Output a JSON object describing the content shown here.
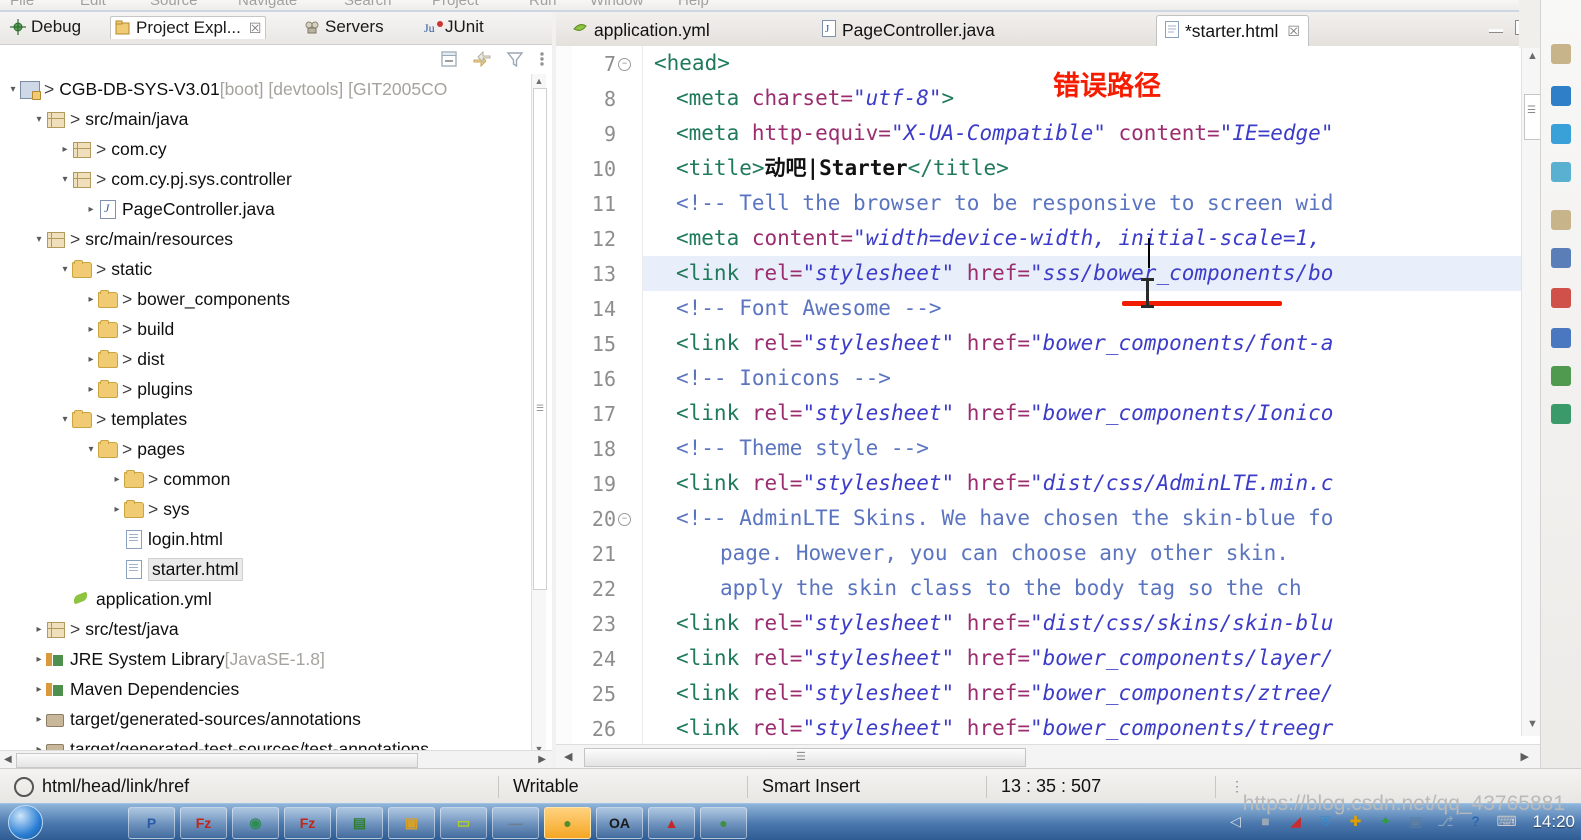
{
  "menu": {
    "items": [
      "File",
      "Edit",
      "Source",
      "Navigate",
      "Search",
      "Project",
      "Run",
      "Window",
      "Help"
    ]
  },
  "left_panel": {
    "view_tabs": [
      {
        "label": "Debug",
        "icon": "debug-icon",
        "active": false
      },
      {
        "label": "Project Expl...",
        "icon": "project-explorer-icon",
        "active": true
      },
      {
        "label": "Servers",
        "icon": "servers-icon",
        "active": false
      },
      {
        "label": "JUnit",
        "icon": "junit-icon",
        "active": false
      }
    ],
    "toolbar": [
      {
        "name": "collapse-all-icon"
      },
      {
        "name": "link-with-editor-icon"
      },
      {
        "name": "filter-icon"
      },
      {
        "name": "view-menu-icon"
      }
    ],
    "tree": [
      {
        "indent": 0,
        "twisty": "open",
        "icon": "project-icon",
        "arrow": ">",
        "label": "CGB-DB-SYS-V3.01",
        "suffix": " [boot] [devtools] [GIT2005CO",
        "selected": false
      },
      {
        "indent": 1,
        "twisty": "open",
        "icon": "source-folder-icon",
        "arrow": ">",
        "label": "src/main/java",
        "suffix": "",
        "selected": false
      },
      {
        "indent": 2,
        "twisty": "closed",
        "icon": "package-icon",
        "arrow": ">",
        "label": "com.cy",
        "suffix": "",
        "selected": false
      },
      {
        "indent": 2,
        "twisty": "open",
        "icon": "package-icon",
        "arrow": ">",
        "label": "com.cy.pj.sys.controller",
        "suffix": "",
        "selected": false
      },
      {
        "indent": 3,
        "twisty": "closed",
        "icon": "java-file-icon",
        "arrow": "",
        "label": "PageController.java",
        "suffix": "",
        "selected": false
      },
      {
        "indent": 1,
        "twisty": "open",
        "icon": "source-folder-icon",
        "arrow": ">",
        "label": "src/main/resources",
        "suffix": "",
        "selected": false
      },
      {
        "indent": 2,
        "twisty": "open",
        "icon": "folder-icon",
        "arrow": ">",
        "label": "static",
        "suffix": "",
        "selected": false
      },
      {
        "indent": 3,
        "twisty": "closed",
        "icon": "folder-icon",
        "arrow": ">",
        "label": "bower_components",
        "suffix": "",
        "selected": false
      },
      {
        "indent": 3,
        "twisty": "closed",
        "icon": "folder-icon",
        "arrow": ">",
        "label": "build",
        "suffix": "",
        "selected": false
      },
      {
        "indent": 3,
        "twisty": "closed",
        "icon": "folder-icon",
        "arrow": ">",
        "label": "dist",
        "suffix": "",
        "selected": false
      },
      {
        "indent": 3,
        "twisty": "closed",
        "icon": "folder-icon",
        "arrow": ">",
        "label": "plugins",
        "suffix": "",
        "selected": false
      },
      {
        "indent": 2,
        "twisty": "open",
        "icon": "folder-icon",
        "arrow": ">",
        "label": "templates",
        "suffix": "",
        "selected": false
      },
      {
        "indent": 3,
        "twisty": "open",
        "icon": "folder-icon",
        "arrow": ">",
        "label": "pages",
        "suffix": "",
        "selected": false
      },
      {
        "indent": 4,
        "twisty": "closed",
        "icon": "folder-icon",
        "arrow": ">",
        "label": "common",
        "suffix": "",
        "selected": false
      },
      {
        "indent": 4,
        "twisty": "closed",
        "icon": "folder-icon",
        "arrow": ">",
        "label": "sys",
        "suffix": "",
        "selected": false
      },
      {
        "indent": 4,
        "twisty": "none",
        "icon": "html-file-icon",
        "arrow": "",
        "label": "login.html",
        "suffix": "",
        "selected": false
      },
      {
        "indent": 4,
        "twisty": "none",
        "icon": "html-file-icon",
        "arrow": "",
        "label": "starter.html",
        "suffix": "",
        "selected": true
      },
      {
        "indent": 2,
        "twisty": "none",
        "icon": "yml-file-icon",
        "arrow": "",
        "label": "application.yml",
        "suffix": "",
        "selected": false
      },
      {
        "indent": 1,
        "twisty": "closed",
        "icon": "source-folder-icon",
        "arrow": ">",
        "label": "src/test/java",
        "suffix": "",
        "selected": false
      },
      {
        "indent": 1,
        "twisty": "closed",
        "icon": "library-icon",
        "arrow": "",
        "label": "JRE System Library",
        "suffix": " [JavaSE-1.8]",
        "selected": false
      },
      {
        "indent": 1,
        "twisty": "closed",
        "icon": "library-icon",
        "arrow": "",
        "label": "Maven Dependencies",
        "suffix": "",
        "selected": false
      },
      {
        "indent": 1,
        "twisty": "closed",
        "icon": "generated-folder-icon",
        "arrow": "",
        "label": "target/generated-sources/annotations",
        "suffix": "",
        "selected": false
      },
      {
        "indent": 1,
        "twisty": "closed",
        "icon": "generated-folder-icon",
        "arrow": "",
        "label": "target/generated-test-sources/test-annotations",
        "suffix": "",
        "selected": false
      }
    ]
  },
  "editor": {
    "tabs": [
      {
        "label": "application.yml",
        "icon": "yml-file-icon",
        "active": false,
        "closable": false
      },
      {
        "label": "PageController.java",
        "icon": "java-file-icon",
        "active": false,
        "closable": false
      },
      {
        "label": "*starter.html",
        "icon": "html-file-icon",
        "active": true,
        "closable": true
      }
    ],
    "close_glyph": "☒",
    "window_buttons": [
      "minimize",
      "maximize"
    ],
    "first_line_number": 7,
    "highlighted_line": 13,
    "lines": [
      {
        "num": 7,
        "fold": "collapse",
        "indent": 0,
        "tokens": [
          {
            "t": "tag",
            "v": "<head>"
          }
        ]
      },
      {
        "num": 8,
        "fold": "",
        "indent": 1,
        "tokens": [
          {
            "t": "tag",
            "v": "<meta "
          },
          {
            "t": "attr",
            "v": "charset="
          },
          {
            "t": "str",
            "v": "\"utf-8\""
          },
          {
            "t": "tag",
            "v": ">"
          }
        ]
      },
      {
        "num": 9,
        "fold": "",
        "indent": 1,
        "tokens": [
          {
            "t": "tag",
            "v": "<meta "
          },
          {
            "t": "attr",
            "v": "http-equiv="
          },
          {
            "t": "str",
            "v": "\"X-UA-Compatible\""
          },
          {
            "t": "attr",
            "v": " content="
          },
          {
            "t": "str",
            "v": "\"IE=edge\""
          }
        ]
      },
      {
        "num": 10,
        "fold": "",
        "indent": 1,
        "tokens": [
          {
            "t": "tag",
            "v": "<title>"
          },
          {
            "t": "txt",
            "v": "动吧|Starter"
          },
          {
            "t": "tag",
            "v": "</title>"
          }
        ]
      },
      {
        "num": 11,
        "fold": "",
        "indent": 1,
        "tokens": [
          {
            "t": "cmt",
            "v": "<!-- Tell the browser to be responsive to screen wid"
          }
        ]
      },
      {
        "num": 12,
        "fold": "",
        "indent": 1,
        "tokens": [
          {
            "t": "tag",
            "v": "<meta "
          },
          {
            "t": "attr",
            "v": "content="
          },
          {
            "t": "str",
            "v": "\"width=device-width, initial-scale=1, "
          }
        ]
      },
      {
        "num": 13,
        "fold": "",
        "indent": 1,
        "tokens": [
          {
            "t": "tag",
            "v": "<link "
          },
          {
            "t": "attr",
            "v": "rel="
          },
          {
            "t": "str",
            "v": "\"stylesheet\""
          },
          {
            "t": "attr",
            "v": " href="
          },
          {
            "t": "str",
            "v": "\"sss/bower_components/bo"
          }
        ]
      },
      {
        "num": 14,
        "fold": "",
        "indent": 1,
        "tokens": [
          {
            "t": "cmt",
            "v": "<!-- Font Awesome -->"
          }
        ]
      },
      {
        "num": 15,
        "fold": "",
        "indent": 1,
        "tokens": [
          {
            "t": "tag",
            "v": "<link "
          },
          {
            "t": "attr",
            "v": "rel="
          },
          {
            "t": "str",
            "v": "\"stylesheet\""
          },
          {
            "t": "attr",
            "v": " href="
          },
          {
            "t": "str",
            "v": "\"bower_components/font-a"
          }
        ]
      },
      {
        "num": 16,
        "fold": "",
        "indent": 1,
        "tokens": [
          {
            "t": "cmt",
            "v": "<!-- Ionicons -->"
          }
        ]
      },
      {
        "num": 17,
        "fold": "",
        "indent": 1,
        "tokens": [
          {
            "t": "tag",
            "v": "<link "
          },
          {
            "t": "attr",
            "v": "rel="
          },
          {
            "t": "str",
            "v": "\"stylesheet\""
          },
          {
            "t": "attr",
            "v": " href="
          },
          {
            "t": "str",
            "v": "\"bower_components/Ionico"
          }
        ]
      },
      {
        "num": 18,
        "fold": "",
        "indent": 1,
        "tokens": [
          {
            "t": "cmt",
            "v": "<!-- Theme style -->"
          }
        ]
      },
      {
        "num": 19,
        "fold": "",
        "indent": 1,
        "tokens": [
          {
            "t": "tag",
            "v": "<link "
          },
          {
            "t": "attr",
            "v": "rel="
          },
          {
            "t": "str",
            "v": "\"stylesheet\""
          },
          {
            "t": "attr",
            "v": " href="
          },
          {
            "t": "str",
            "v": "\"dist/css/AdminLTE.min.c"
          }
        ]
      },
      {
        "num": 20,
        "fold": "collapse",
        "indent": 1,
        "tokens": [
          {
            "t": "cmt",
            "v": "<!-- AdminLTE Skins. We have chosen the skin-blue fo"
          }
        ]
      },
      {
        "num": 21,
        "fold": "",
        "indent": 3,
        "tokens": [
          {
            "t": "cmt",
            "v": "page. However, you can choose any other skin. "
          }
        ]
      },
      {
        "num": 22,
        "fold": "",
        "indent": 3,
        "tokens": [
          {
            "t": "cmt",
            "v": "apply the skin class to the body tag so the ch"
          }
        ]
      },
      {
        "num": 23,
        "fold": "",
        "indent": 1,
        "tokens": [
          {
            "t": "tag",
            "v": "<link "
          },
          {
            "t": "attr",
            "v": "rel="
          },
          {
            "t": "str",
            "v": "\"stylesheet\""
          },
          {
            "t": "attr",
            "v": " href="
          },
          {
            "t": "str",
            "v": "\"dist/css/skins/skin-blu"
          }
        ]
      },
      {
        "num": 24,
        "fold": "",
        "indent": 1,
        "tokens": [
          {
            "t": "tag",
            "v": "<link "
          },
          {
            "t": "attr",
            "v": "rel="
          },
          {
            "t": "str",
            "v": "\"stylesheet\""
          },
          {
            "t": "attr",
            "v": " href="
          },
          {
            "t": "str",
            "v": "\"bower_components/layer/"
          }
        ]
      },
      {
        "num": 25,
        "fold": "",
        "indent": 1,
        "tokens": [
          {
            "t": "tag",
            "v": "<link "
          },
          {
            "t": "attr",
            "v": "rel="
          },
          {
            "t": "str",
            "v": "\"stylesheet\""
          },
          {
            "t": "attr",
            "v": " href="
          },
          {
            "t": "str",
            "v": "\"bower_components/ztree/"
          }
        ]
      },
      {
        "num": 26,
        "fold": "",
        "indent": 1,
        "tokens": [
          {
            "t": "tag",
            "v": "<link "
          },
          {
            "t": "attr",
            "v": "rel="
          },
          {
            "t": "str",
            "v": "\"stylesheet\""
          },
          {
            "t": "attr",
            "v": " href="
          },
          {
            "t": "str",
            "v": "\"bower_components/treegr"
          }
        ]
      }
    ]
  },
  "annotation": {
    "text": "错误路径",
    "color": "#f51c00",
    "underline_color": "#f21c00"
  },
  "status_bar": {
    "breadcrumb": "html/head/link/href",
    "writable": "Writable",
    "insert_mode": "Smart Insert",
    "position": "13 : 35 : 507"
  },
  "taskbar": {
    "items": [
      {
        "name": "taskbar-item-powerpoint",
        "glyph": "P",
        "color": "#2a5caa",
        "hot": false
      },
      {
        "name": "taskbar-item-filezilla",
        "glyph": "Fz",
        "color": "#c0271a",
        "hot": false
      },
      {
        "name": "taskbar-item-chrome",
        "glyph": "◉",
        "color": "#2e8b57",
        "hot": false
      },
      {
        "name": "taskbar-item-filezilla-2",
        "glyph": "Fz",
        "color": "#c0271a",
        "hot": false
      },
      {
        "name": "taskbar-item-notepad",
        "glyph": "▤",
        "color": "#2e7d32",
        "hot": false
      },
      {
        "name": "taskbar-item-explorer",
        "glyph": "▣",
        "color": "#d6a12a",
        "hot": false
      },
      {
        "name": "taskbar-item-editor",
        "glyph": "▭",
        "color": "#b5c92a",
        "hot": false
      },
      {
        "name": "taskbar-item-tool",
        "glyph": "—",
        "color": "#6f7d8c",
        "hot": false
      },
      {
        "name": "taskbar-item-eclipse",
        "glyph": "●",
        "color": "#4e8f2f",
        "hot": true
      },
      {
        "name": "taskbar-item-cmd",
        "glyph": "OA",
        "color": "#1a1a1a",
        "hot": false
      },
      {
        "name": "taskbar-item-navicat",
        "glyph": "▲",
        "color": "#c62828",
        "hot": false
      },
      {
        "name": "taskbar-item-browser",
        "glyph": "●",
        "color": "#3f8f3f",
        "hot": false
      }
    ],
    "tray": [
      {
        "name": "tray-keyboard-icon",
        "glyph": "⌨",
        "color": "#c9c9c9"
      },
      {
        "name": "tray-help-icon",
        "glyph": "?",
        "color": "#1a5fb4"
      },
      {
        "name": "tray-network-icon",
        "glyph": "⎇",
        "color": "#8ea4bd"
      },
      {
        "name": "tray-monitor-icon",
        "glyph": "▣",
        "color": "#5b7fa6"
      },
      {
        "name": "tray-shield-green-icon",
        "glyph": "✦",
        "color": "#2e9e3a"
      },
      {
        "name": "tray-plus-icon",
        "glyph": "✚",
        "color": "#e0a000"
      },
      {
        "name": "tray-security-icon",
        "glyph": "⛨",
        "color": "#2b8fd6"
      },
      {
        "name": "tray-flag-icon",
        "glyph": "◢",
        "color": "#cc2b2b"
      },
      {
        "name": "tray-display-icon",
        "glyph": "■",
        "color": "#9aa7b4"
      },
      {
        "name": "tray-volume-icon",
        "glyph": "◁",
        "color": "#d8dde3"
      }
    ],
    "clock": "14:20"
  },
  "watermark": "https://blog.csdn.net/qq_43765881"
}
